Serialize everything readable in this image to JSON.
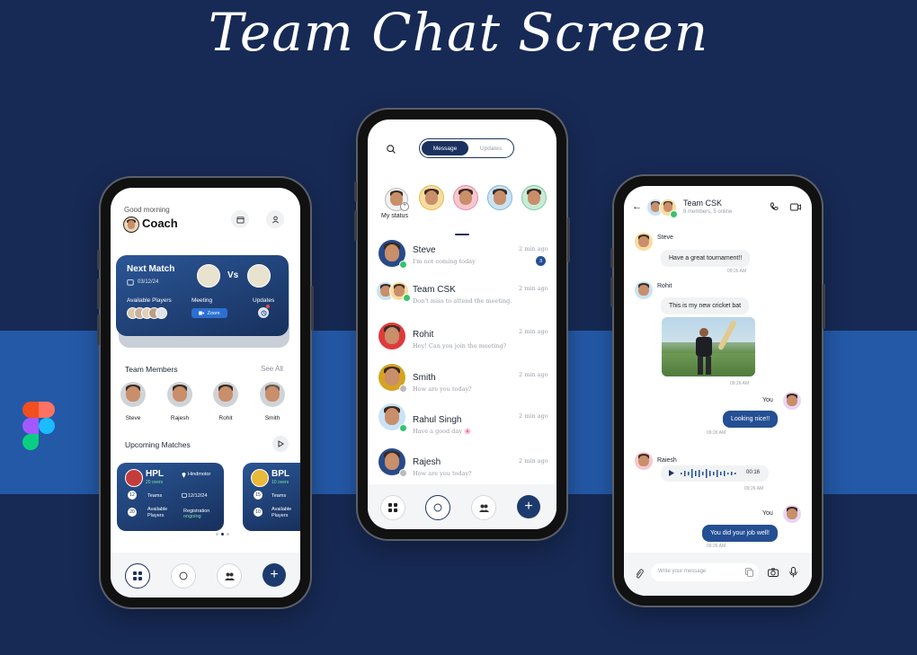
{
  "title": "Team Chat Screen",
  "colors": {
    "navy": "#1b3260",
    "accent": "#244f93",
    "green": "#35c46b",
    "bg": "#172a55",
    "band": "#2459a8"
  },
  "home": {
    "greeting": "Good morning",
    "user": "Coach",
    "next_match": {
      "title": "Next Match",
      "date": "03/12/24",
      "vs": "Vs",
      "available_label": "Available Players",
      "meeting_label": "Meeting",
      "zoom": "Zoom",
      "updates_label": "Updates"
    },
    "team_members": {
      "title": "Team Members",
      "see_all": "See All",
      "members": [
        "Steve",
        "Rajesh",
        "Rohit",
        "Smith"
      ]
    },
    "upcoming": {
      "title": "Upcoming Matches",
      "cards": [
        {
          "name": "HPL",
          "overs": "20 overs",
          "location": "Hindmotor",
          "teams_count": "12",
          "teams_label": "Teams",
          "date": "12/12/24",
          "players_count": "20",
          "players_label": "Available Players",
          "reg_label": "Registration",
          "reg_status": "ongoing"
        },
        {
          "name": "BPL",
          "overs": "10 overs",
          "teams_count": "15",
          "teams_label": "Teams",
          "players_count": "10",
          "players_label": "Available Players"
        }
      ]
    }
  },
  "messages": {
    "tabs": [
      "Message",
      "Updates"
    ],
    "my_status": "My status",
    "chats": [
      {
        "name": "Steve",
        "message": "I'm not coming today",
        "time": "2 min ago",
        "unread": "3"
      },
      {
        "name": "Team CSK",
        "message": "Don't miss to attend the meeting.",
        "time": "2 min ago"
      },
      {
        "name": "Rohit",
        "message": "Hey! Can you join the meeting?",
        "time": "2 min ago"
      },
      {
        "name": "Smith",
        "message": "How are you today?",
        "time": "2 min ago"
      },
      {
        "name": "Rahul Singh",
        "message": "Have a good day 🌸",
        "time": "2 min ago"
      },
      {
        "name": "Rajesh",
        "message": "How are you today?",
        "time": "2 min ago"
      }
    ]
  },
  "chat": {
    "group_name": "Team CSK",
    "group_meta": "8 members, 5 online",
    "thread": [
      {
        "sender": "Steve",
        "text": "Have a great tournament!!",
        "time": "09:26 AM"
      },
      {
        "sender": "Rohit",
        "text": "This is my new cricket bat",
        "time": "09:26 AM"
      },
      {
        "sender": "You",
        "text": "Looking nice!!",
        "time": "09:26 AM"
      },
      {
        "sender": "Raiesh",
        "voice_duration": "00:16",
        "time": "09:26 AM"
      },
      {
        "sender": "You",
        "text": "You did your job well!",
        "time": "09:26 AM"
      }
    ],
    "input_placeholder": "Write your message"
  }
}
